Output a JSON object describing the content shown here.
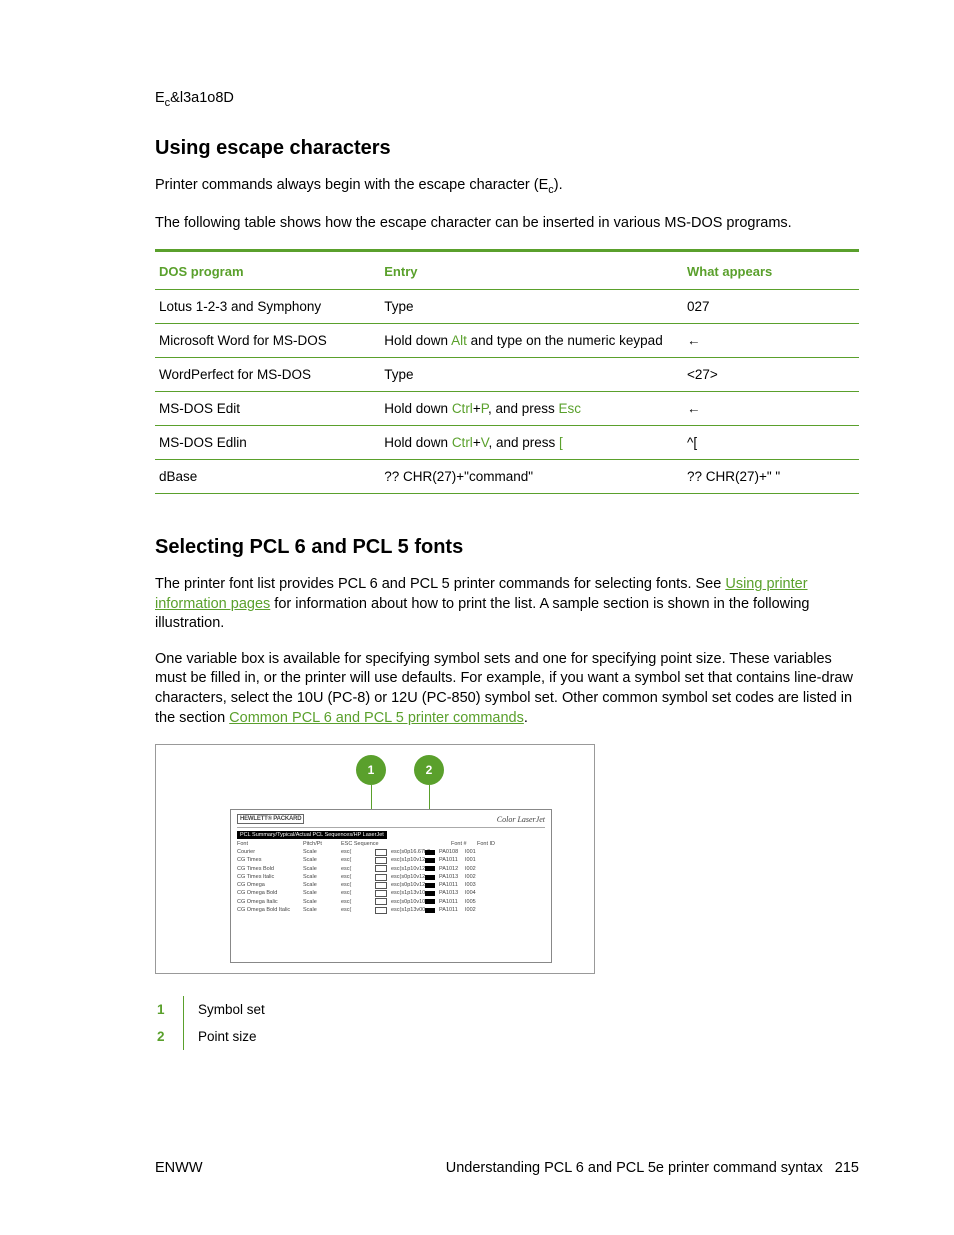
{
  "codeLine": {
    "pre": "E",
    "sub": "c",
    "post": "&l3a1o8D"
  },
  "section1": {
    "heading": "Using escape characters",
    "para1_pre": "Printer commands always begin with the escape character (E",
    "para1_sub": "c",
    "para1_post": ").",
    "para2": "The following table shows how the escape character can be inserted in various MS-DOS programs."
  },
  "escTable": {
    "headers": {
      "c1": "DOS program",
      "c2": "Entry",
      "c3": "What appears"
    },
    "rows": [
      {
        "program": "Lotus 1-2-3 and Symphony",
        "entry_plain": "Type",
        "appears": "027"
      },
      {
        "program": "Microsoft Word for MS-DOS",
        "entry_parts": {
          "a": "Hold down ",
          "k1": "Alt",
          "b": " and type          on the numeric keypad"
        },
        "appears": "←"
      },
      {
        "program": "WordPerfect for MS-DOS",
        "entry_plain": "Type",
        "appears": "<27>"
      },
      {
        "program": "MS-DOS Edit",
        "entry_parts": {
          "a": "Hold down ",
          "k1": "Ctrl",
          "plus": "+",
          "k2": "P",
          "b": ", and press ",
          "k3": "Esc"
        },
        "appears": "←"
      },
      {
        "program": "MS-DOS Edlin",
        "entry_parts": {
          "a": "Hold down ",
          "k1": "Ctrl",
          "plus": "+",
          "k2": "V",
          "b": ", and press ",
          "k3": "["
        },
        "appears": "^["
      },
      {
        "program": "dBase",
        "entry_plain": "?? CHR(27)+\"command\"",
        "appears": "?? CHR(27)+\" \""
      }
    ]
  },
  "section2": {
    "heading": "Selecting PCL 6 and PCL 5 fonts",
    "p1a": "The printer font list provides PCL 6 and PCL 5 printer commands for selecting fonts. See ",
    "p1link": "Using printer information pages",
    "p1b": " for information about how to print the list. A sample section is shown in the following illustration.",
    "p2a": "One variable box is available for specifying symbol sets and one for specifying point size. These variables must be filled in, or the printer will use defaults. For example, if you want a symbol set that contains line-draw characters, select the 10U (PC-8) or 12U (PC-850) symbol set. Other common symbol set codes are listed in the section ",
    "p2link": "Common PCL 6 and PCL 5 printer commands",
    "p2b": "."
  },
  "figure": {
    "balloon1": "1",
    "balloon2": "2",
    "hp": "HEWLETT® PACKARD",
    "clj": "Color LaserJet",
    "title": "PCL Summary/Typical/Actual PCL Sequences/HP LaserJet",
    "cols": {
      "font": "Font",
      "pitch": "Pitch/Pt",
      "seq": "ESC Sequence",
      "fontn": "Font #",
      "fontid": "Font ID"
    },
    "rows": [
      {
        "c1": "Courier",
        "c2": "Scale",
        "c3": "esc(",
        "c5": "esc(s0p16.67h0",
        "c6": "PA0108",
        "c7": "I001"
      },
      {
        "c1": "CG Times",
        "c2": "Scale",
        "c3": "esc(",
        "c5": "esc(s1p10v12",
        "c6": "PA1011",
        "c7": "I001"
      },
      {
        "c1": "CG Times Bold",
        "c2": "Scale",
        "c3": "esc(",
        "c5": "esc(s1p10v12",
        "c6": "PA1012",
        "c7": "I002"
      },
      {
        "c1": "CG Times Italic",
        "c2": "Scale",
        "c3": "esc(",
        "c5": "esc(s0p10v12",
        "c6": "PA1013",
        "c7": "I002"
      },
      {
        "c1": "CG Omega",
        "c2": "Scale",
        "c3": "esc(",
        "c5": "esc(s0p10v12",
        "c6": "PA1011",
        "c7": "I003"
      },
      {
        "c1": "CG Omega Bold",
        "c2": "Scale",
        "c3": "esc(",
        "c5": "esc(s1p13v10",
        "c6": "PA1013",
        "c7": "I004"
      },
      {
        "c1": "CG Omega Italic",
        "c2": "Scale",
        "c3": "esc(",
        "c5": "esc(s0p10v10",
        "c6": "PA1011",
        "c7": "I005"
      },
      {
        "c1": "CG Omega Bold Italic",
        "c2": "Scale",
        "c3": "esc(",
        "c5": "esc(s1p13v00",
        "c6": "PA1011",
        "c7": "I002"
      }
    ]
  },
  "callouts": [
    {
      "num": "1",
      "text": "Symbol set"
    },
    {
      "num": "2",
      "text": "Point size"
    }
  ],
  "footer": {
    "left": "ENWW",
    "rightText": "Understanding PCL 6 and PCL 5e printer command syntax",
    "rightPage": "215"
  }
}
